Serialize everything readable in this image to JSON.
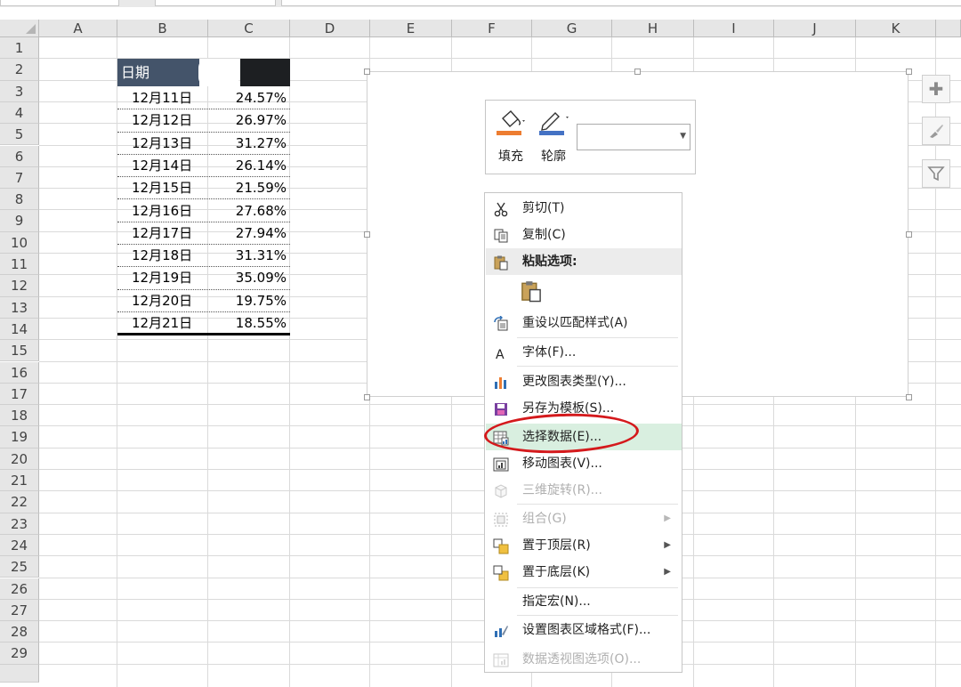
{
  "columns": [
    "A",
    "B",
    "C",
    "D",
    "E",
    "F",
    "G",
    "H",
    "I",
    "J",
    "K"
  ],
  "rows": [
    "1",
    "2",
    "3",
    "4",
    "5",
    "6",
    "7",
    "8",
    "9",
    "10",
    "11",
    "12",
    "13",
    "14",
    "15",
    "16",
    "17",
    "18",
    "19",
    "20",
    "21",
    "22",
    "23",
    "24",
    "25",
    "26",
    "27",
    "28",
    "29"
  ],
  "table": {
    "header": "日期",
    "rows": [
      {
        "date": "12月11日",
        "value": "24.57%"
      },
      {
        "date": "12月12日",
        "value": "26.97%"
      },
      {
        "date": "12月13日",
        "value": "31.27%"
      },
      {
        "date": "12月14日",
        "value": "26.14%"
      },
      {
        "date": "12月15日",
        "value": "21.59%"
      },
      {
        "date": "12月16日",
        "value": "27.68%"
      },
      {
        "date": "12月17日",
        "value": "27.94%"
      },
      {
        "date": "12月18日",
        "value": "31.31%"
      },
      {
        "date": "12月19日",
        "value": "35.09%"
      },
      {
        "date": "12月20日",
        "value": "19.75%"
      },
      {
        "date": "12月21日",
        "value": "18.55%"
      }
    ]
  },
  "minibar": {
    "fill_label": "填充",
    "outline_label": "轮廓",
    "dropdown_value": ""
  },
  "context_menu": {
    "items": [
      {
        "label": "剪切(T)",
        "icon": "scissors-icon",
        "enabled": true
      },
      {
        "label": "复制(C)",
        "icon": "copy-icon",
        "enabled": true
      },
      {
        "label": "粘贴选项:",
        "icon": "paste-icon",
        "section": true
      },
      {
        "label": "",
        "icon": "paste-option-icon",
        "enabled": true
      },
      {
        "label": "重设以匹配样式(A)",
        "icon": "reset-style-icon",
        "enabled": true
      },
      {
        "label": "字体(F)...",
        "icon": "font-icon",
        "enabled": true
      },
      {
        "label": "更改图表类型(Y)...",
        "icon": "chart-type-icon",
        "enabled": true
      },
      {
        "label": "另存为模板(S)...",
        "icon": "save-template-icon",
        "enabled": true
      },
      {
        "label": "选择数据(E)...",
        "icon": "select-data-icon",
        "enabled": true,
        "highlighted": true
      },
      {
        "label": "移动图表(V)...",
        "icon": "move-chart-icon",
        "enabled": true
      },
      {
        "label": "三维旋转(R)...",
        "icon": "rotate-3d-icon",
        "enabled": false
      },
      {
        "label": "组合(G)",
        "icon": "group-icon",
        "enabled": false,
        "submenu": true
      },
      {
        "label": "置于顶层(R)",
        "icon": "bring-front-icon",
        "enabled": true,
        "submenu": true
      },
      {
        "label": "置于底层(K)",
        "icon": "send-back-icon",
        "enabled": true,
        "submenu": true
      },
      {
        "label": "指定宏(N)...",
        "icon": "",
        "enabled": true
      },
      {
        "label": "设置图表区域格式(F)...",
        "icon": "format-chart-area-icon",
        "enabled": true
      },
      {
        "label": "数据透视图选项(O)...",
        "icon": "pivot-options-icon",
        "enabled": false
      }
    ]
  },
  "colors": {
    "header_bg": "#44546a",
    "highlight": "#d9efe0",
    "red_circle": "#d4191c",
    "fill_orange": "#ed7d31",
    "outline_blue": "#4472c4"
  }
}
